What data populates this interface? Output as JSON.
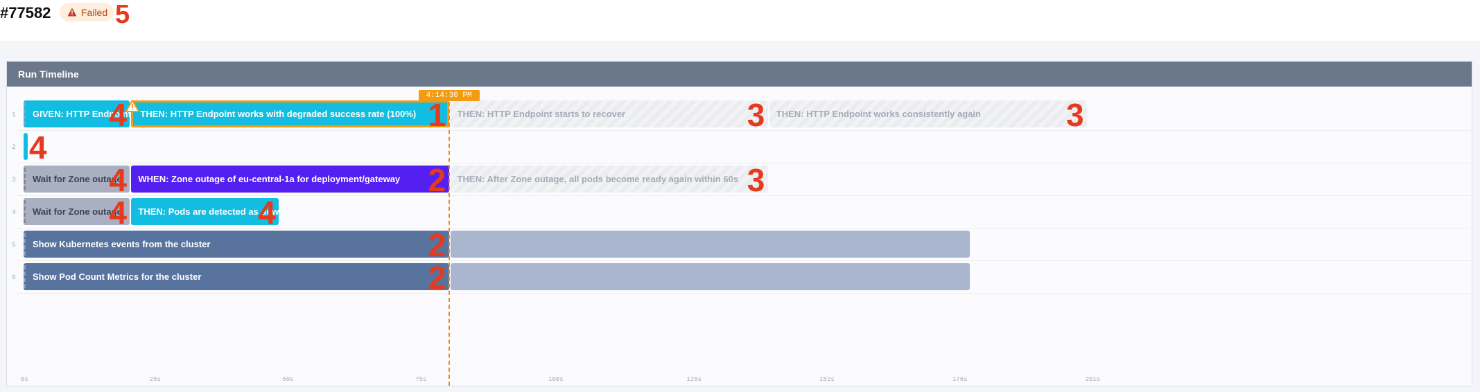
{
  "header": {
    "run_id": "#77582",
    "status": "Failed",
    "status_icon": "warning-triangle-icon",
    "step_marker": "5"
  },
  "panel": {
    "title": "Run Timeline"
  },
  "now_marker": {
    "time": "4:14:30 PM",
    "seconds": 80
  },
  "rows": [
    {
      "num": "1",
      "bars": [
        {
          "label": "GIVEN: HTTP Endpoint works",
          "style": "done-cyan",
          "start": 0,
          "end": 20,
          "marker": "4"
        },
        {
          "label": "THEN: HTTP Endpoint works with degraded success rate (100%)",
          "style": "active",
          "start": 20,
          "end": 80,
          "marker": "1"
        },
        {
          "label": "THEN: HTTP Endpoint starts to recover",
          "style": "pending",
          "start": 80,
          "end": 140,
          "marker": "3"
        },
        {
          "label": "THEN: HTTP Endpoint works consistently again",
          "style": "pending",
          "start": 140,
          "end": 200,
          "marker": "3"
        }
      ]
    },
    {
      "num": "2",
      "bars": [
        {
          "label": "",
          "style": "thin",
          "start": 0,
          "end": 0.6,
          "marker": "4"
        }
      ]
    },
    {
      "num": "3",
      "bars": [
        {
          "label": "Wait for Zone outage",
          "style": "gray",
          "start": 0,
          "end": 20,
          "marker": "4"
        },
        {
          "label": "WHEN: Zone outage of eu-central-1a for deployment/gateway",
          "style": "purple",
          "start": 20,
          "end": 80,
          "marker": "2"
        },
        {
          "label": "THEN: After Zone outage, all pods become ready again within 60s",
          "style": "pending",
          "start": 80,
          "end": 140,
          "marker": "3"
        }
      ]
    },
    {
      "num": "4",
      "bars": [
        {
          "label": "Wait for Zone outage",
          "style": "gray",
          "start": 0,
          "end": 20,
          "marker": "4"
        },
        {
          "label": "THEN: Pods are detected as down",
          "style": "done-cyan",
          "start": 20,
          "end": 48,
          "marker": "4"
        }
      ]
    },
    {
      "num": "5",
      "bars": [
        {
          "label": "Show Kubernetes events from the cluster",
          "style": "slate",
          "start": 0,
          "end": 80,
          "marker": "2"
        },
        {
          "label": "",
          "style": "ghost",
          "start": 80,
          "end": 178,
          "marker": ""
        }
      ]
    },
    {
      "num": "6",
      "bars": [
        {
          "label": "Show Pod Count Metrics for the cluster",
          "style": "slate",
          "start": 0,
          "end": 80,
          "marker": "2"
        },
        {
          "label": "",
          "style": "ghost",
          "start": 80,
          "end": 178,
          "marker": ""
        }
      ]
    }
  ],
  "axis": {
    "ticks": [
      {
        "label": "0s",
        "value": 0
      },
      {
        "label": "25s",
        "value": 25
      },
      {
        "label": "50s",
        "value": 50
      },
      {
        "label": "75s",
        "value": 75
      },
      {
        "label": "100s",
        "value": 100
      },
      {
        "label": "126s",
        "value": 126
      },
      {
        "label": "151s",
        "value": 151
      },
      {
        "label": "176s",
        "value": 176
      },
      {
        "label": "201s",
        "value": 201
      }
    ]
  },
  "colors": {
    "accent_orange": "#f39c12",
    "cyan": "#12bde1",
    "purple": "#5420f2",
    "slate": "#58739e",
    "marker_red": "#e53a1e"
  }
}
